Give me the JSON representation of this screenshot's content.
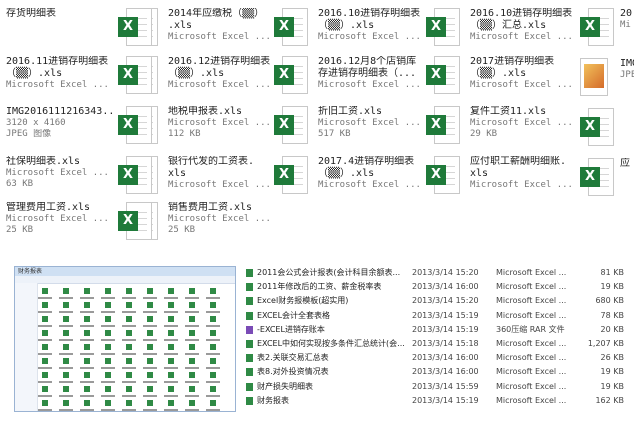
{
  "top_tiles": [
    {
      "name": "存货明细表",
      "sub1": "",
      "sub2": "",
      "icon": "excel"
    },
    {
      "name": "2014年应缴税（▒▒）\n.xls",
      "sub1": "Microsoft Excel ...",
      "sub2": "",
      "icon": "excel"
    },
    {
      "name": "2016.10进销存明细表\n（▒▒）.xls",
      "sub1": "Microsoft Excel ...",
      "sub2": "",
      "icon": "excel"
    },
    {
      "name": "2016.10进销存明细表\n（▒▒）汇总.xls",
      "sub1": "Microsoft Excel ...",
      "sub2": "",
      "icon": "excel"
    },
    {
      "name": "2016.11进销存明细表\n（▒▒）.xls",
      "sub1": "Microsoft Excel ...",
      "sub2": "",
      "icon": "excel"
    },
    {
      "name": "2016.12进销存明细表\n（▒▒）.xls",
      "sub1": "Microsoft Excel ...",
      "sub2": "",
      "icon": "excel"
    },
    {
      "name": "2016.12月8个店销库\n存进销存明细表（...",
      "sub1": "Microsoft Excel ...",
      "sub2": "",
      "icon": "excel"
    },
    {
      "name": "2017进销存明细表\n（▒▒）.xls",
      "sub1": "Microsoft Excel ...",
      "sub2": "",
      "icon": "excel"
    },
    {
      "name": "IMG2016111216343...",
      "sub1": "3120 x 4160",
      "sub2": "JPEG 图像",
      "icon": "excel-blank"
    },
    {
      "name": "地税申报表.xls",
      "sub1": "Microsoft Excel ...",
      "sub2": "112 KB",
      "icon": "excel"
    },
    {
      "name": "折旧工资.xls",
      "sub1": "Microsoft Excel ...",
      "sub2": "517 KB",
      "icon": "excel"
    },
    {
      "name": "复件工资11.xls",
      "sub1": "Microsoft Excel ...",
      "sub2": "29 KB",
      "icon": "excel"
    },
    {
      "name": "社保明细表.xls",
      "sub1": "Microsoft Excel ...",
      "sub2": "63 KB",
      "icon": "excel-blank"
    },
    {
      "name": "银行代发的工资表.\nxls",
      "sub1": "Microsoft Excel ...",
      "sub2": "",
      "icon": "excel"
    },
    {
      "name": "2017.4进销存明细表\n（▒▒）.xls",
      "sub1": "Microsoft Excel ...",
      "sub2": "",
      "icon": "excel"
    },
    {
      "name": "应付职工薪酬明细账.\nxls",
      "sub1": "Microsoft Excel ...",
      "sub2": "",
      "icon": "excel"
    },
    {
      "name": "管理费用工资.xls",
      "sub1": "Microsoft Excel ...",
      "sub2": "25 KB",
      "icon": "excel-blank"
    },
    {
      "name": "销售费用工资.xls",
      "sub1": "Microsoft Excel ...",
      "sub2": "25 KB",
      "icon": "excel"
    }
  ],
  "right_edge_tiles": [
    {
      "name": "20",
      "sub1": "Mi",
      "icon": "excel"
    },
    {
      "name": "IMG",
      "sub1": "JPE",
      "icon": "image"
    },
    {
      "name": "",
      "sub1": "",
      "icon": "excel"
    },
    {
      "name": "应",
      "sub1": "",
      "icon": "excel"
    }
  ],
  "mini_window": {
    "title": "财务报表"
  },
  "file_list": [
    {
      "name": "2011会公式会计报表(会计科目余额表...",
      "date": "2013/3/14 15:20",
      "type": "Microsoft Excel ...",
      "size": "81 KB",
      "icon": "excel"
    },
    {
      "name": "2011年修改后的工资、薪金税率表",
      "date": "2013/3/14 16:00",
      "type": "Microsoft Excel ...",
      "size": "19 KB",
      "icon": "excel"
    },
    {
      "name": "Excel财务报模板(超实用)",
      "date": "2013/3/14 15:20",
      "type": "Microsoft Excel ...",
      "size": "680 KB",
      "icon": "excel"
    },
    {
      "name": "EXCEL会计全套表格",
      "date": "2013/3/14 15:19",
      "type": "Microsoft Excel ...",
      "size": "78 KB",
      "icon": "excel"
    },
    {
      "name": "-EXCEL进销存账本",
      "date": "2013/3/14 15:19",
      "type": "360压缩 RAR 文件",
      "size": "20 KB",
      "icon": "rar"
    },
    {
      "name": "EXCEL中如何实现按多条件汇总统计(会...",
      "date": "2013/3/14 15:18",
      "type": "Microsoft Excel ...",
      "size": "1,207 KB",
      "icon": "excel"
    },
    {
      "name": "表2.关联交易汇总表",
      "date": "2013/3/14 16:00",
      "type": "Microsoft Excel ...",
      "size": "26 KB",
      "icon": "excel"
    },
    {
      "name": "表8.对外投资情况表",
      "date": "2013/3/14 16:00",
      "type": "Microsoft Excel ...",
      "size": "19 KB",
      "icon": "excel"
    },
    {
      "name": "财产损失明细表",
      "date": "2013/3/14 15:59",
      "type": "Microsoft Excel ...",
      "size": "19 KB",
      "icon": "excel"
    },
    {
      "name": "财务报表",
      "date": "2013/3/14 15:19",
      "type": "Microsoft Excel ...",
      "size": "162 KB",
      "icon": "excel"
    }
  ]
}
